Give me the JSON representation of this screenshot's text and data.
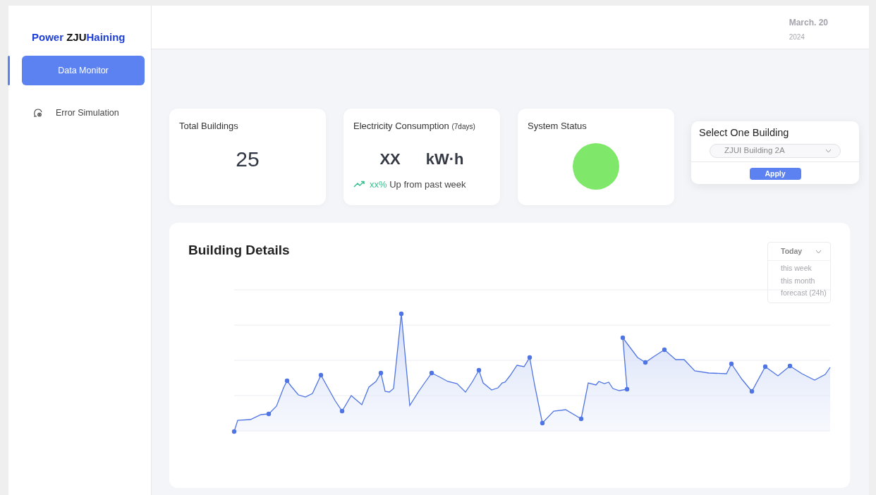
{
  "brand": [
    {
      "text": "Power ",
      "accent": true
    },
    {
      "text": "ZJU",
      "accent": false
    },
    {
      "text": "Haining",
      "accent": true
    }
  ],
  "sidebar": {
    "items": [
      {
        "label": "Data Monitor",
        "kind": "plain",
        "selected": true
      },
      {
        "label": "Error Simulation",
        "kind": "icon",
        "selected": false
      }
    ]
  },
  "header": {
    "date": "March. 20",
    "year": "2024"
  },
  "stats": [
    {
      "kind": "number",
      "title": "Total Buildings",
      "value": "25"
    },
    {
      "kind": "consumption",
      "title": "Electricity Consumption",
      "title_note": "(7days)",
      "value": "XX",
      "unit": "kW·h",
      "trend_value": "xx%",
      "trend_text": "Up from past week"
    },
    {
      "kind": "status",
      "title": "System Status",
      "color": "#7fe86a"
    }
  ],
  "building_select": {
    "title": "Select One Building",
    "value": "ZJUI Building 2A",
    "button": "Apply"
  },
  "details": {
    "title": "Building Details",
    "ranges": [
      {
        "label": "Today",
        "selected": true
      },
      {
        "label": "this week",
        "selected": false
      },
      {
        "label": "this month",
        "selected": false
      },
      {
        "label": "forecast (24h)",
        "selected": false
      }
    ]
  }
}
